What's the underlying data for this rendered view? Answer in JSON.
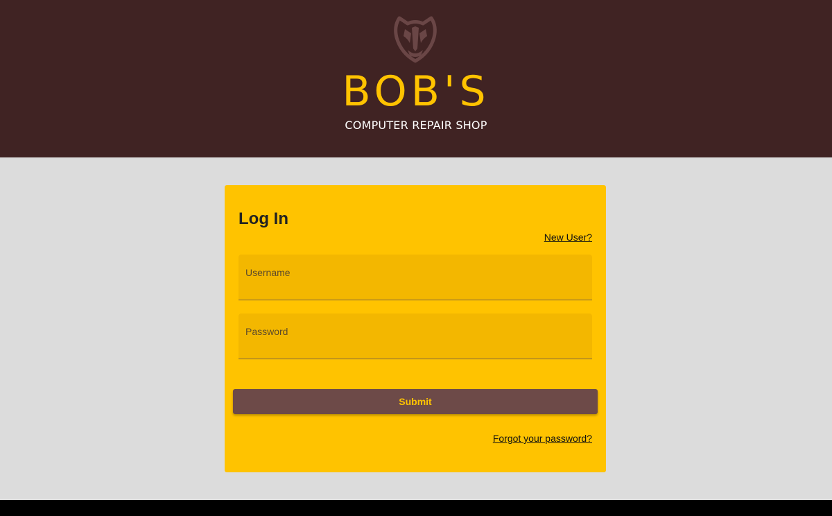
{
  "header": {
    "logo_icon": "badger-icon",
    "brand_name": "BOB'S",
    "tagline": "COMPUTER REPAIR SHOP"
  },
  "login": {
    "title": "Log In",
    "new_user_link": "New User?",
    "username_label": "Username",
    "password_label": "Password",
    "submit_label": "Submit",
    "forgot_link": "Forgot your password?"
  },
  "colors": {
    "header_bg": "#402323",
    "accent": "#ffc300",
    "page_bg": "#dcdcdc",
    "button_bg": "#6d4a48",
    "footer_bg": "#000000"
  }
}
